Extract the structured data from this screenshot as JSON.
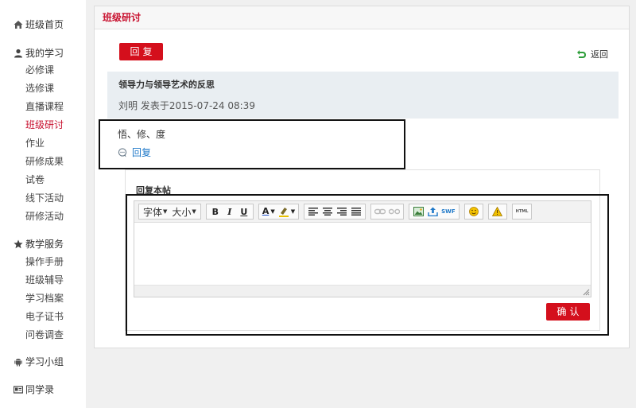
{
  "sidebar": {
    "home": "班级首页",
    "my_study": {
      "heading": "我的学习",
      "items": [
        "必修课",
        "选修课",
        "直播课程",
        "班级研讨",
        "作业",
        "研修成果",
        "试卷",
        "线下活动",
        "研修活动"
      ]
    },
    "teaching": {
      "heading": "教学服务",
      "items": [
        "操作手册",
        "班级辅导",
        "学习档案",
        "电子证书",
        "问卷调查"
      ]
    },
    "group": "学习小组",
    "classmates": "同学录"
  },
  "panel": {
    "title": "班级研讨",
    "reply_button": "回复",
    "back_label": "返回"
  },
  "post": {
    "title": "领导力与领导艺术的反思",
    "meta": "刘明 发表于2015-07-24 08:39",
    "content": "悟、修、度",
    "reply_link": "回复"
  },
  "reply_form": {
    "label": "回复本帖",
    "font_select": "字体",
    "size_select": "大小",
    "bold": "B",
    "italic": "I",
    "underline": "U",
    "font_color": "A",
    "swf": "SWF",
    "html": "HTML",
    "confirm": "确认"
  },
  "colors": {
    "accent_red": "#d40f1c",
    "link_blue": "#1e78c8"
  }
}
